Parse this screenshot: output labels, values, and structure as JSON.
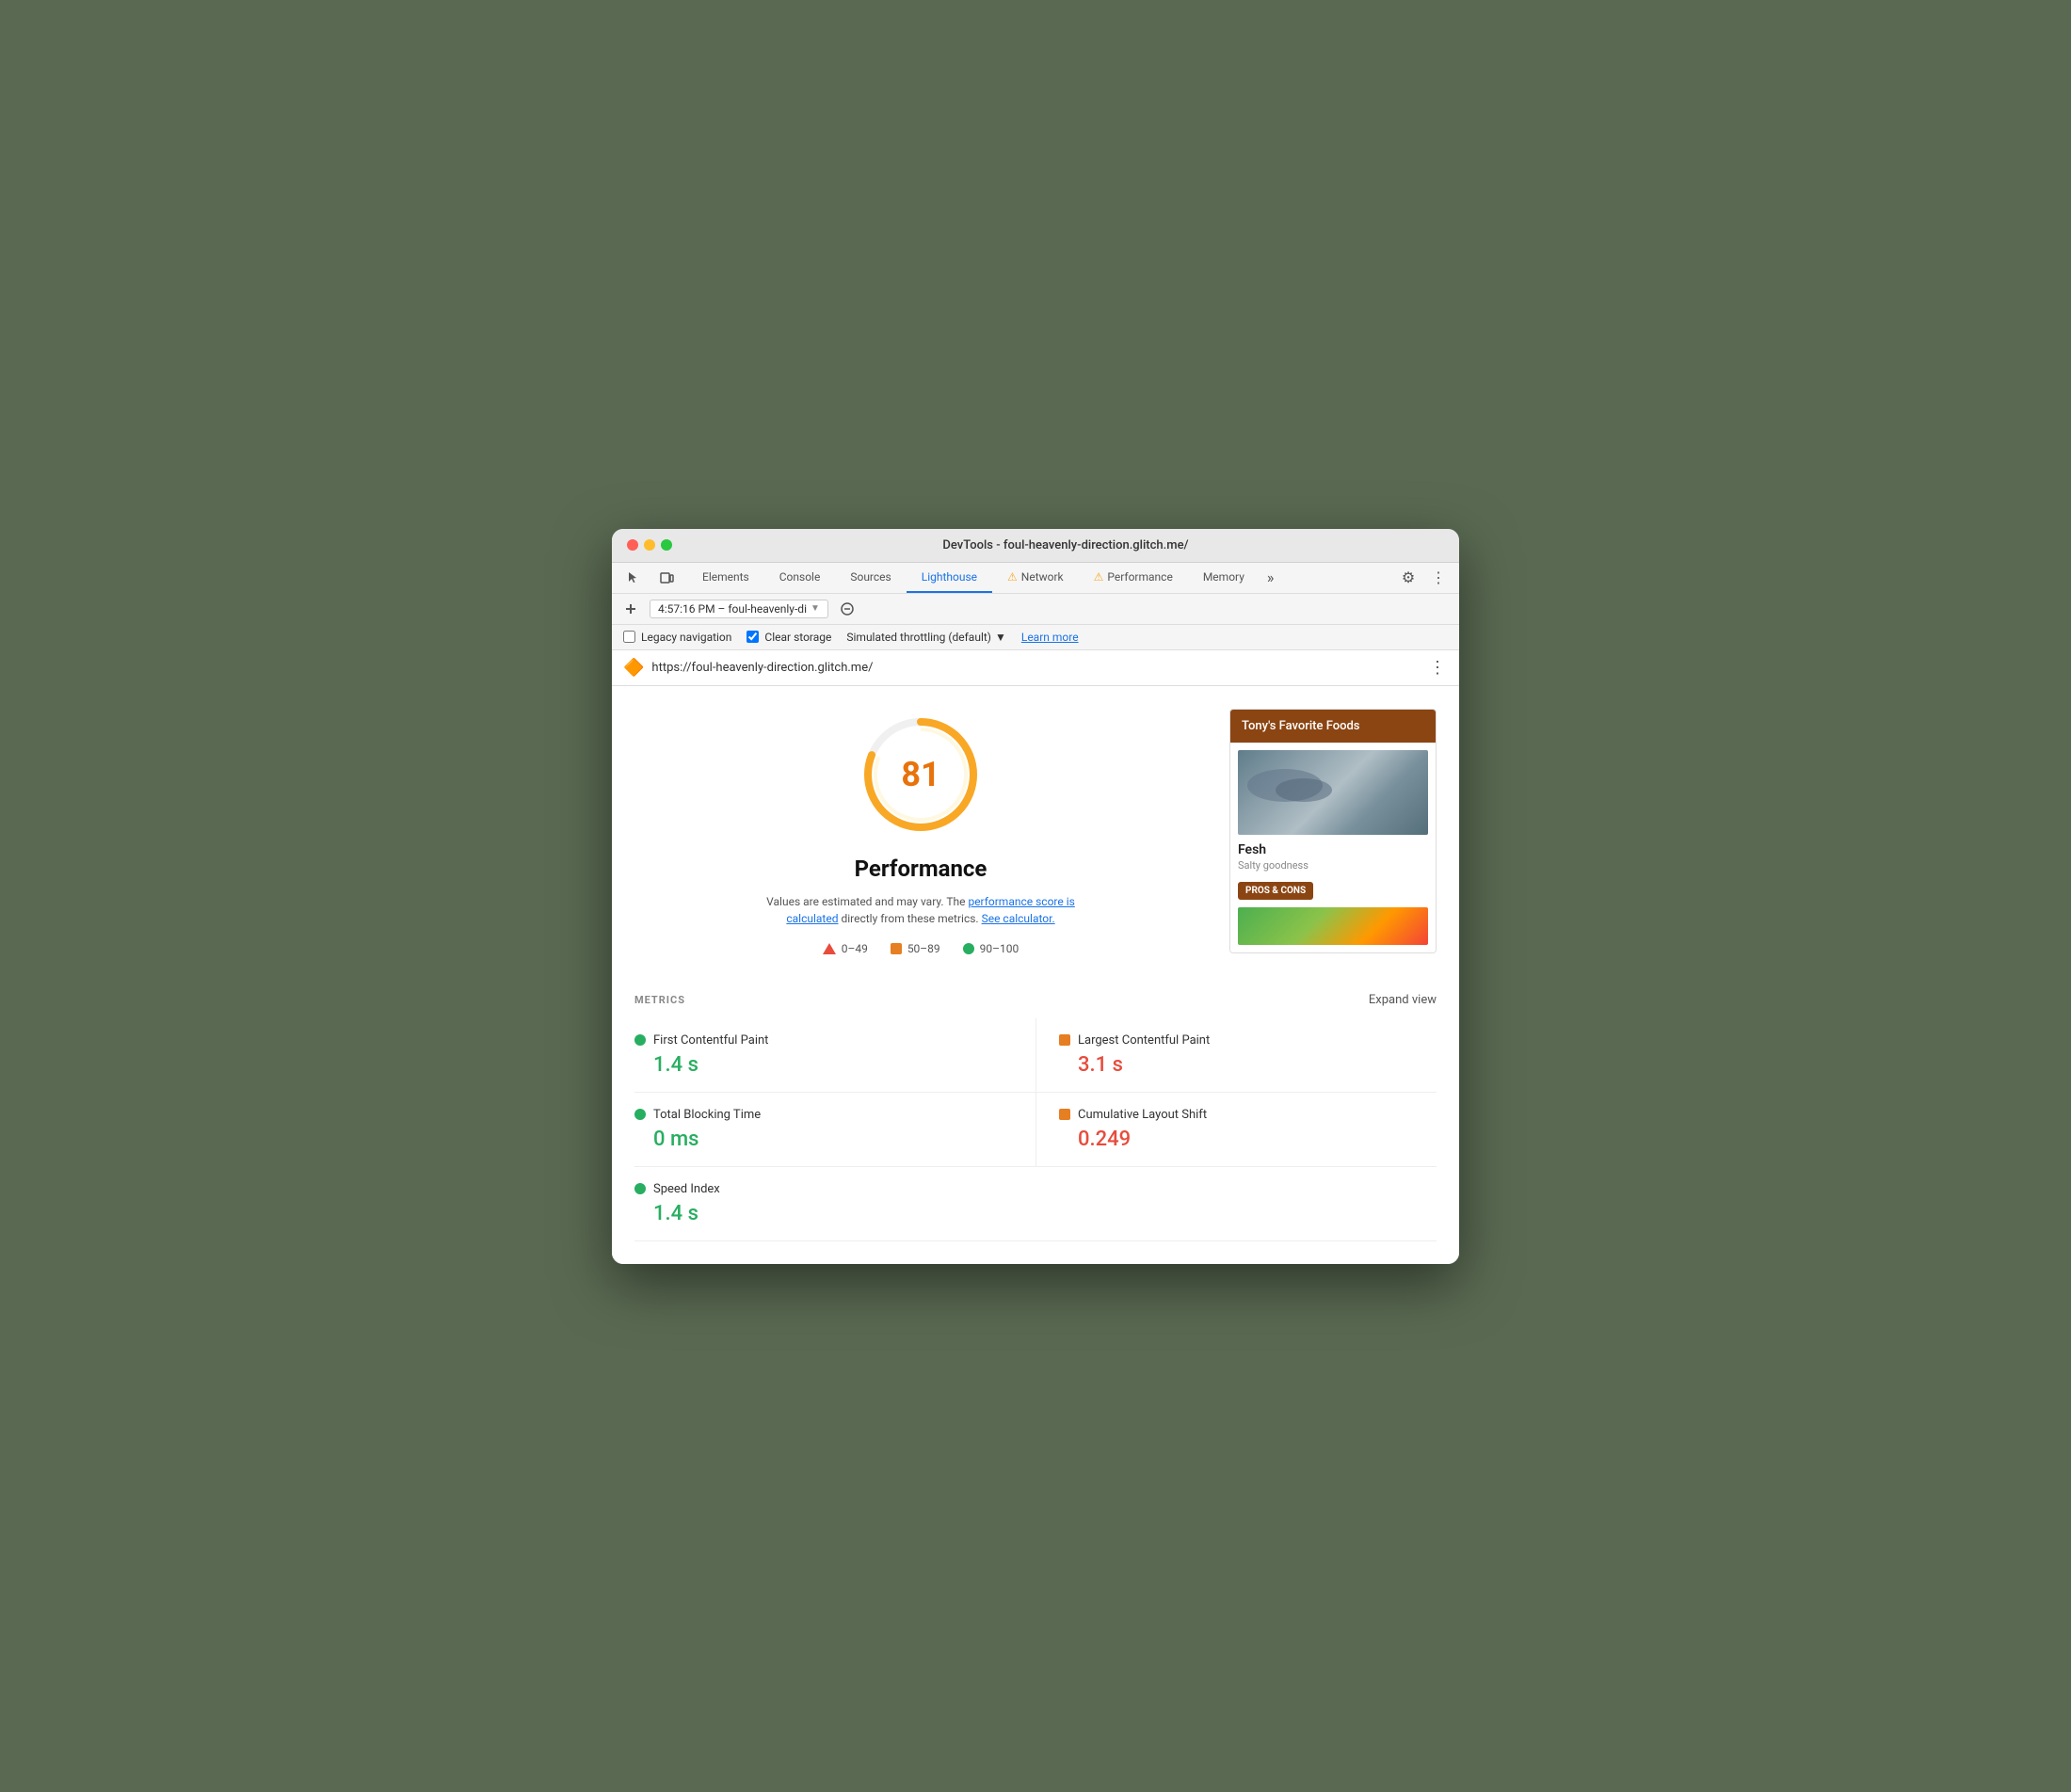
{
  "window": {
    "title": "DevTools - foul-heavenly-direction.glitch.me/"
  },
  "tabs": {
    "elements": "Elements",
    "console": "Console",
    "sources": "Sources",
    "lighthouse": "Lighthouse",
    "network": "Network",
    "performance": "Performance",
    "memory": "Memory",
    "more": "»"
  },
  "toolbar": {
    "session_label": "4:57:16 PM – foul-heavenly-di",
    "settings_icon": "⚙",
    "more_icon": "⋮"
  },
  "options": {
    "legacy_nav": "Legacy navigation",
    "clear_storage": "Clear storage",
    "throttle": "Simulated throttling (default)",
    "throttle_arrow": "▼",
    "learn_more": "Learn more"
  },
  "url_bar": {
    "icon": "🔶",
    "url": "https://foul-heavenly-direction.glitch.me/",
    "more_icon": "⋮"
  },
  "score": {
    "value": "81",
    "title": "Performance",
    "desc_start": "Values are estimated and may vary. The",
    "desc_link1": "performance score is calculated",
    "desc_mid": "directly from these metrics.",
    "desc_link2": "See calculator.",
    "range1": "0–49",
    "range2": "50–89",
    "range3": "90–100"
  },
  "preview": {
    "header": "Tony's Favorite Foods",
    "food_name": "Fesh",
    "food_desc": "Salty goodness",
    "btn_label": "PROS & CONS"
  },
  "metrics": {
    "label": "METRICS",
    "expand": "Expand view",
    "items": [
      {
        "name": "First Contentful Paint",
        "value": "1.4 s",
        "color": "green"
      },
      {
        "name": "Largest Contentful Paint",
        "value": "3.1 s",
        "color": "orange"
      },
      {
        "name": "Total Blocking Time",
        "value": "0 ms",
        "color": "green"
      },
      {
        "name": "Cumulative Layout Shift",
        "value": "0.249",
        "color": "orange"
      },
      {
        "name": "Speed Index",
        "value": "1.4 s",
        "color": "green"
      }
    ]
  }
}
